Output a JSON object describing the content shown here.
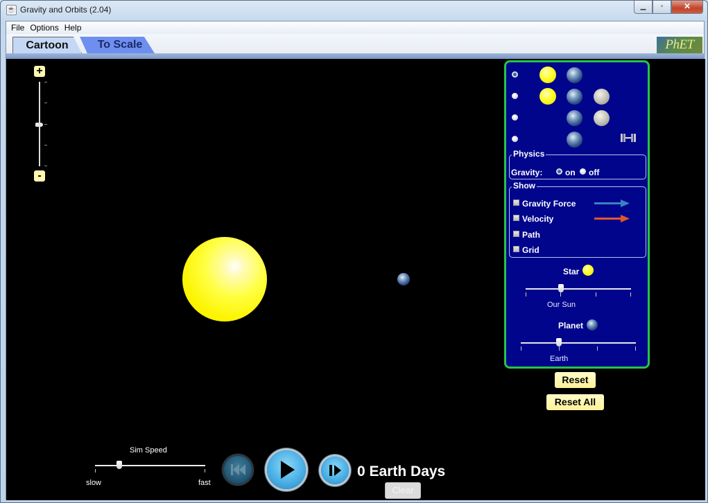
{
  "window": {
    "title": "Gravity and Orbits (2.04)",
    "controls": {
      "minimize": "▁",
      "maximize": "▫",
      "close": "✕"
    }
  },
  "menu": [
    "File",
    "Options",
    "Help"
  ],
  "tabs": [
    {
      "label": "Cartoon",
      "selected": true
    },
    {
      "label": "To Scale",
      "selected": false
    }
  ],
  "logo": "PhET",
  "zoom": {
    "plus": "+",
    "minus": "-",
    "level": 0.5
  },
  "scene": {
    "bodies": [
      {
        "name": "sun",
        "icon": "sun"
      },
      {
        "name": "earth",
        "icon": "earth"
      }
    ]
  },
  "panel": {
    "scenarios": [
      {
        "selected": true,
        "bodies": [
          "sun",
          "earth"
        ]
      },
      {
        "selected": false,
        "bodies": [
          "sun",
          "earth",
          "moon"
        ]
      },
      {
        "selected": false,
        "bodies": [
          "earth",
          "moon"
        ]
      },
      {
        "selected": false,
        "bodies": [
          "earth",
          "satellite"
        ]
      }
    ],
    "physics": {
      "title": "Physics",
      "gravity_label": "Gravity:",
      "on_label": "on",
      "off_label": "off",
      "gravity_on": true
    },
    "show": {
      "title": "Show",
      "items": [
        {
          "label": "Gravity Force",
          "checked": false,
          "arrow_color": "#3b82c4"
        },
        {
          "label": "Velocity",
          "checked": false,
          "arrow_color": "#e2552a"
        },
        {
          "label": "Path",
          "checked": false
        },
        {
          "label": "Grid",
          "checked": false
        }
      ]
    },
    "star": {
      "label": "Star",
      "value_label": "Our Sun",
      "position": 0.33
    },
    "planet": {
      "label": "Planet",
      "value_label": "Earth",
      "position": 0.33
    }
  },
  "buttons": {
    "reset": "Reset",
    "reset_all": "Reset All"
  },
  "bottom": {
    "sim_speed_label": "Sim Speed",
    "slow_label": "slow",
    "fast_label": "fast",
    "speed_position": 0.22,
    "elapsed": "0 Earth Days",
    "clear": "Clear"
  },
  "colors": {
    "panel_bg": "#00058c",
    "panel_border": "#27c447",
    "button_yellow": "#fff29a"
  }
}
